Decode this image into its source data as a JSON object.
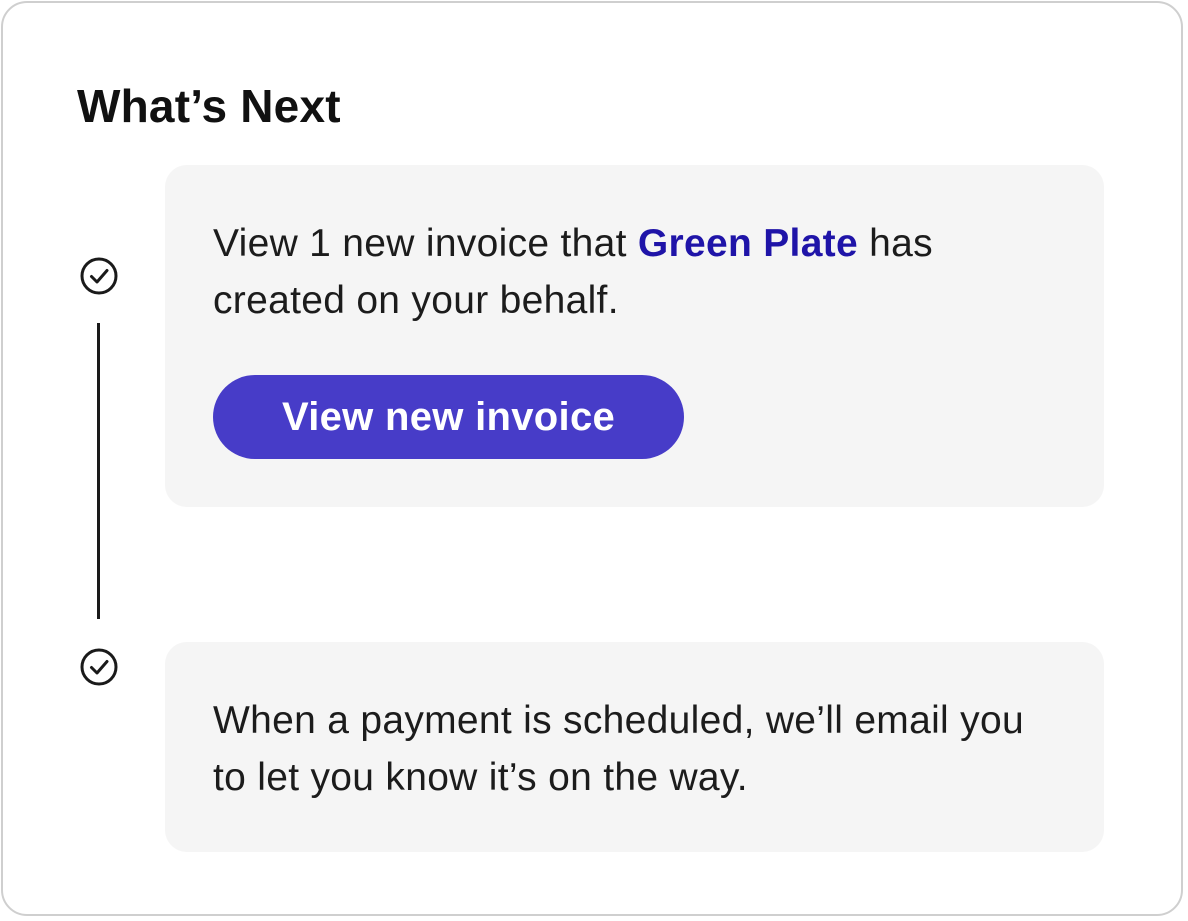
{
  "header": {
    "title": "What’s Next"
  },
  "steps": [
    {
      "icon": "check-circle-icon",
      "text_before": "View 1 new invoice that ",
      "link_text": "Green Plate",
      "text_after": " has created on your behalf.",
      "button_label": "View new invoice"
    },
    {
      "icon": "check-circle-icon",
      "text": "When a payment is scheduled, we’ll email you to let you know it’s on the way."
    }
  ],
  "colors": {
    "accent": "#473cc8",
    "brand_link": "#1f14a8",
    "panel_bg": "#f5f5f5",
    "border": "#cfcfcf"
  }
}
